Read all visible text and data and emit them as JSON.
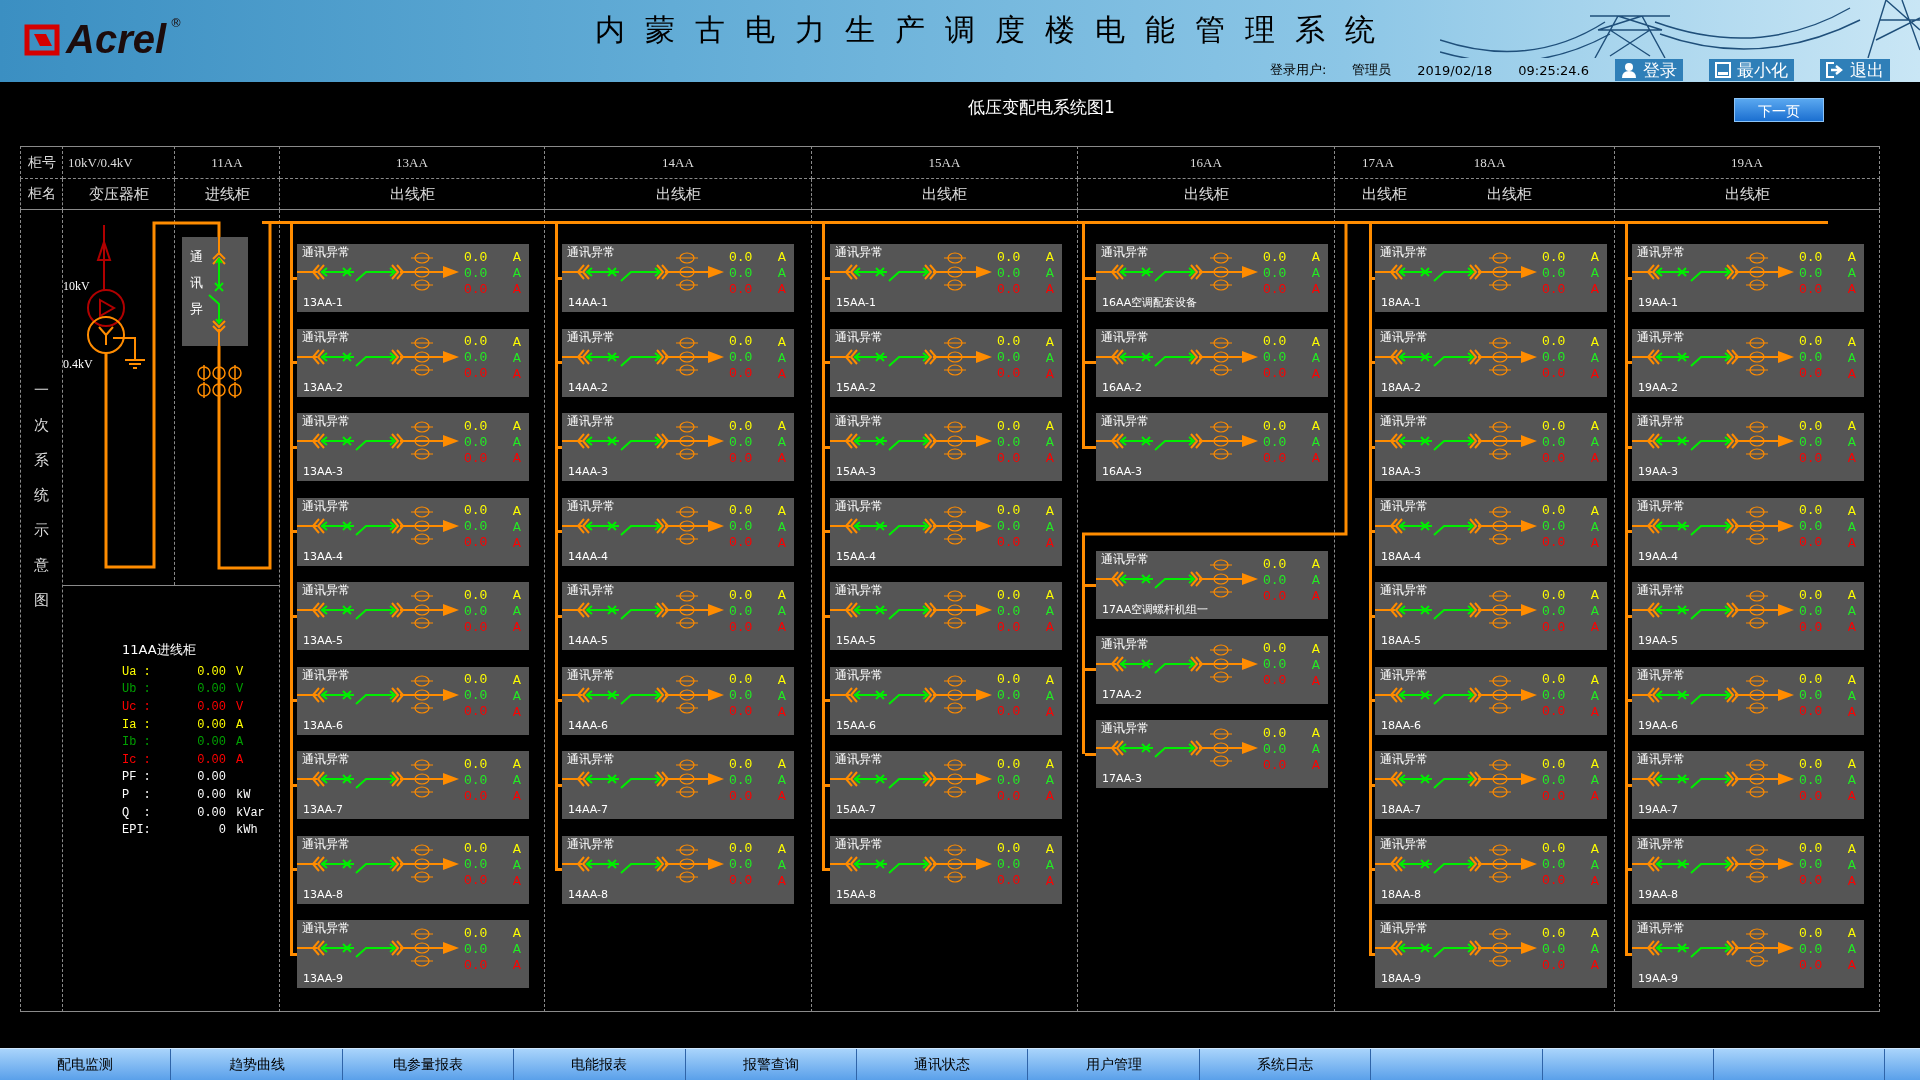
{
  "header": {
    "logo": "Acrel",
    "logo_mark": "®",
    "title": "内蒙古电力生产调度楼电能管理系统",
    "user_label": "登录用户:",
    "user": "管理员",
    "date": "2019/02/18",
    "time": "09:25:24.6",
    "buttons": [
      {
        "kind": "login",
        "label": "登录"
      },
      {
        "kind": "minimize",
        "label": "最小化"
      },
      {
        "kind": "exit",
        "label": "退出"
      }
    ]
  },
  "page_title": "低压变配电系统图1",
  "next_button": "下一页",
  "table": {
    "row_labels": [
      "柜号",
      "柜名"
    ],
    "side_label": "一次系统示意图",
    "columns": [
      {
        "numbers": [
          "10kV/0.4kV"
        ],
        "names": [
          "变压器柜"
        ]
      },
      {
        "numbers": [
          "11AA"
        ],
        "names": [
          "进线柜"
        ]
      },
      {
        "numbers": [
          "13AA"
        ],
        "names": [
          "出线柜"
        ]
      },
      {
        "numbers": [
          "14AA"
        ],
        "names": [
          "出线柜"
        ]
      },
      {
        "numbers": [
          "15AA"
        ],
        "names": [
          "出线柜"
        ]
      },
      {
        "numbers": [
          "16AA"
        ],
        "names": [
          "出线柜"
        ]
      },
      {
        "numbers": [
          "17AA",
          "18AA"
        ],
        "names": [
          "出线柜",
          "出线柜"
        ]
      },
      {
        "numbers": [
          "19AA"
        ],
        "names": [
          "出线柜"
        ]
      }
    ]
  },
  "transformer": {
    "hv_label": "10kV",
    "lv_label": "0.4kV"
  },
  "incomer": {
    "status": "通讯异"
  },
  "incomer_readings": {
    "title": "11AA进线柜",
    "rows": [
      {
        "label": "Ua :",
        "value": "0.00",
        "unit": "V",
        "color": "#ffff00"
      },
      {
        "label": "Ub :",
        "value": "0.00",
        "unit": "V",
        "color": "#00a000"
      },
      {
        "label": "Uc :",
        "value": "0.00",
        "unit": "V",
        "color": "#ff0000"
      },
      {
        "label": "Ia :",
        "value": "0.00",
        "unit": "A",
        "color": "#ffff00"
      },
      {
        "label": "Ib :",
        "value": "0.00",
        "unit": "A",
        "color": "#00a000"
      },
      {
        "label": "Ic :",
        "value": "0.00",
        "unit": "A",
        "color": "#ff0000"
      },
      {
        "label": "PF :",
        "value": "0.00",
        "color": "#ffffff"
      },
      {
        "label": "P  :",
        "value": "0.00",
        "unit": "kW",
        "color": "#ffffff"
      },
      {
        "label": "Q  :",
        "value": "0.00",
        "unit": "kVar",
        "color": "#ffffff"
      },
      {
        "label": "EPI:",
        "value": "0",
        "unit": "kWh",
        "color": "#ffffff"
      }
    ]
  },
  "feeders": [
    {
      "groups": [
        {
          "cards": [
            {
              "status": "通讯异常",
              "name": "13AA-1",
              "values": [
                "0.0",
                "0.0",
                "0.0"
              ],
              "units": [
                "A",
                "A",
                "A"
              ]
            },
            {
              "status": "通讯异常",
              "name": "13AA-2",
              "values": [
                "0.0",
                "0.0",
                "0.0"
              ],
              "units": [
                "A",
                "A",
                "A"
              ]
            },
            {
              "status": "通讯异常",
              "name": "13AA-3",
              "values": [
                "0.0",
                "0.0",
                "0.0"
              ],
              "units": [
                "A",
                "A",
                "A"
              ]
            },
            {
              "status": "通讯异常",
              "name": "13AA-4",
              "values": [
                "0.0",
                "0.0",
                "0.0"
              ],
              "units": [
                "A",
                "A",
                "A"
              ]
            },
            {
              "status": "通讯异常",
              "name": "13AA-5",
              "values": [
                "0.0",
                "0.0",
                "0.0"
              ],
              "units": [
                "A",
                "A",
                "A"
              ]
            },
            {
              "status": "通讯异常",
              "name": "13AA-6",
              "values": [
                "0.0",
                "0.0",
                "0.0"
              ],
              "units": [
                "A",
                "A",
                "A"
              ]
            },
            {
              "status": "通讯异常",
              "name": "13AA-7",
              "values": [
                "0.0",
                "0.0",
                "0.0"
              ],
              "units": [
                "A",
                "A",
                "A"
              ]
            },
            {
              "status": "通讯异常",
              "name": "13AA-8",
              "values": [
                "0.0",
                "0.0",
                "0.0"
              ],
              "units": [
                "A",
                "A",
                "A"
              ]
            },
            {
              "status": "通讯异常",
              "name": "13AA-9",
              "values": [
                "0.0",
                "0.0",
                "0.0"
              ],
              "units": [
                "A",
                "A",
                "A"
              ]
            }
          ]
        }
      ]
    },
    {
      "groups": [
        {
          "cards": [
            {
              "status": "通讯异常",
              "name": "14AA-1",
              "values": [
                "0.0",
                "0.0",
                "0.0"
              ],
              "units": [
                "A",
                "A",
                "A"
              ]
            },
            {
              "status": "通讯异常",
              "name": "14AA-2",
              "values": [
                "0.0",
                "0.0",
                "0.0"
              ],
              "units": [
                "A",
                "A",
                "A"
              ]
            },
            {
              "status": "通讯异常",
              "name": "14AA-3",
              "values": [
                "0.0",
                "0.0",
                "0.0"
              ],
              "units": [
                "A",
                "A",
                "A"
              ]
            },
            {
              "status": "通讯异常",
              "name": "14AA-4",
              "values": [
                "0.0",
                "0.0",
                "0.0"
              ],
              "units": [
                "A",
                "A",
                "A"
              ]
            },
            {
              "status": "通讯异常",
              "name": "14AA-5",
              "values": [
                "0.0",
                "0.0",
                "0.0"
              ],
              "units": [
                "A",
                "A",
                "A"
              ]
            },
            {
              "status": "通讯异常",
              "name": "14AA-6",
              "values": [
                "0.0",
                "0.0",
                "0.0"
              ],
              "units": [
                "A",
                "A",
                "A"
              ]
            },
            {
              "status": "通讯异常",
              "name": "14AA-7",
              "values": [
                "0.0",
                "0.0",
                "0.0"
              ],
              "units": [
                "A",
                "A",
                "A"
              ]
            },
            {
              "status": "通讯异常",
              "name": "14AA-8",
              "values": [
                "0.0",
                "0.0",
                "0.0"
              ],
              "units": [
                "A",
                "A",
                "A"
              ]
            }
          ]
        }
      ]
    },
    {
      "groups": [
        {
          "cards": [
            {
              "status": "通讯异常",
              "name": "15AA-1",
              "values": [
                "0.0",
                "0.0",
                "0.0"
              ],
              "units": [
                "A",
                "A",
                "A"
              ]
            },
            {
              "status": "通讯异常",
              "name": "15AA-2",
              "values": [
                "0.0",
                "0.0",
                "0.0"
              ],
              "units": [
                "A",
                "A",
                "A"
              ]
            },
            {
              "status": "通讯异常",
              "name": "15AA-3",
              "values": [
                "0.0",
                "0.0",
                "0.0"
              ],
              "units": [
                "A",
                "A",
                "A"
              ]
            },
            {
              "status": "通讯异常",
              "name": "15AA-4",
              "values": [
                "0.0",
                "0.0",
                "0.0"
              ],
              "units": [
                "A",
                "A",
                "A"
              ]
            },
            {
              "status": "通讯异常",
              "name": "15AA-5",
              "values": [
                "0.0",
                "0.0",
                "0.0"
              ],
              "units": [
                "A",
                "A",
                "A"
              ]
            },
            {
              "status": "通讯异常",
              "name": "15AA-6",
              "values": [
                "0.0",
                "0.0",
                "0.0"
              ],
              "units": [
                "A",
                "A",
                "A"
              ]
            },
            {
              "status": "通讯异常",
              "name": "15AA-7",
              "values": [
                "0.0",
                "0.0",
                "0.0"
              ],
              "units": [
                "A",
                "A",
                "A"
              ]
            },
            {
              "status": "通讯异常",
              "name": "15AA-8",
              "values": [
                "0.0",
                "0.0",
                "0.0"
              ],
              "units": [
                "A",
                "A",
                "A"
              ]
            }
          ]
        }
      ]
    },
    {
      "groups": [
        {
          "cards": [
            {
              "status": "通讯异常",
              "name": "16AA空调配套设备",
              "values": [
                "0.0",
                "0.0",
                "0.0"
              ],
              "units": [
                "A",
                "A",
                "A"
              ]
            },
            {
              "status": "通讯异常",
              "name": "16AA-2",
              "values": [
                "0.0",
                "0.0",
                "0.0"
              ],
              "units": [
                "A",
                "A",
                "A"
              ]
            },
            {
              "status": "通讯异常",
              "name": "16AA-3",
              "values": [
                "0.0",
                "0.0",
                "0.0"
              ],
              "units": [
                "A",
                "A",
                "A"
              ]
            }
          ]
        },
        {
          "cards": [
            {
              "status": "通讯异常",
              "name": "17AA空调螺杆机组一",
              "values": [
                "0.0",
                "0.0",
                "0.0"
              ],
              "units": [
                "A",
                "A",
                "A"
              ]
            },
            {
              "status": "通讯异常",
              "name": "17AA-2",
              "values": [
                "0.0",
                "0.0",
                "0.0"
              ],
              "units": [
                "A",
                "A",
                "A"
              ]
            },
            {
              "status": "通讯异常",
              "name": "17AA-3",
              "values": [
                "0.0",
                "0.0",
                "0.0"
              ],
              "units": [
                "A",
                "A",
                "A"
              ]
            }
          ]
        }
      ]
    },
    {
      "groups": [
        {
          "cards": [
            {
              "status": "通讯异常",
              "name": "18AA-1",
              "values": [
                "0.0",
                "0.0",
                "0.0"
              ],
              "units": [
                "A",
                "A",
                "A"
              ]
            },
            {
              "status": "通讯异常",
              "name": "18AA-2",
              "values": [
                "0.0",
                "0.0",
                "0.0"
              ],
              "units": [
                "A",
                "A",
                "A"
              ]
            },
            {
              "status": "通讯异常",
              "name": "18AA-3",
              "values": [
                "0.0",
                "0.0",
                "0.0"
              ],
              "units": [
                "A",
                "A",
                "A"
              ]
            },
            {
              "status": "通讯异常",
              "name": "18AA-4",
              "values": [
                "0.0",
                "0.0",
                "0.0"
              ],
              "units": [
                "A",
                "A",
                "A"
              ]
            },
            {
              "status": "通讯异常",
              "name": "18AA-5",
              "values": [
                "0.0",
                "0.0",
                "0.0"
              ],
              "units": [
                "A",
                "A",
                "A"
              ]
            },
            {
              "status": "通讯异常",
              "name": "18AA-6",
              "values": [
                "0.0",
                "0.0",
                "0.0"
              ],
              "units": [
                "A",
                "A",
                "A"
              ]
            },
            {
              "status": "通讯异常",
              "name": "18AA-7",
              "values": [
                "0.0",
                "0.0",
                "0.0"
              ],
              "units": [
                "A",
                "A",
                "A"
              ]
            },
            {
              "status": "通讯异常",
              "name": "18AA-8",
              "values": [
                "0.0",
                "0.0",
                "0.0"
              ],
              "units": [
                "A",
                "A",
                "A"
              ]
            },
            {
              "status": "通讯异常",
              "name": "18AA-9",
              "values": [
                "0.0",
                "0.0",
                "0.0"
              ],
              "units": [
                "A",
                "A",
                "A"
              ]
            }
          ]
        }
      ]
    },
    {
      "groups": [
        {
          "cards": [
            {
              "status": "通讯异常",
              "name": "19AA-1",
              "values": [
                "0.0",
                "0.0",
                "0.0"
              ],
              "units": [
                "A",
                "A",
                "A"
              ]
            },
            {
              "status": "通讯异常",
              "name": "19AA-2",
              "values": [
                "0.0",
                "0.0",
                "0.0"
              ],
              "units": [
                "A",
                "A",
                "A"
              ]
            },
            {
              "status": "通讯异常",
              "name": "19AA-3",
              "values": [
                "0.0",
                "0.0",
                "0.0"
              ],
              "units": [
                "A",
                "A",
                "A"
              ]
            },
            {
              "status": "通讯异常",
              "name": "19AA-4",
              "values": [
                "0.0",
                "0.0",
                "0.0"
              ],
              "units": [
                "A",
                "A",
                "A"
              ]
            },
            {
              "status": "通讯异常",
              "name": "19AA-5",
              "values": [
                "0.0",
                "0.0",
                "0.0"
              ],
              "units": [
                "A",
                "A",
                "A"
              ]
            },
            {
              "status": "通讯异常",
              "name": "19AA-6",
              "values": [
                "0.0",
                "0.0",
                "0.0"
              ],
              "units": [
                "A",
                "A",
                "A"
              ]
            },
            {
              "status": "通讯异常",
              "name": "19AA-7",
              "values": [
                "0.0",
                "0.0",
                "0.0"
              ],
              "units": [
                "A",
                "A",
                "A"
              ]
            },
            {
              "status": "通讯异常",
              "name": "19AA-8",
              "values": [
                "0.0",
                "0.0",
                "0.0"
              ],
              "units": [
                "A",
                "A",
                "A"
              ]
            },
            {
              "status": "通讯异常",
              "name": "19AA-9",
              "values": [
                "0.0",
                "0.0",
                "0.0"
              ],
              "units": [
                "A",
                "A",
                "A"
              ]
            }
          ]
        }
      ]
    }
  ],
  "nav": [
    "配电监测",
    "趋势曲线",
    "电参量报表",
    "电能报表",
    "报警查询",
    "通讯状态",
    "用户管理",
    "系统日志"
  ]
}
